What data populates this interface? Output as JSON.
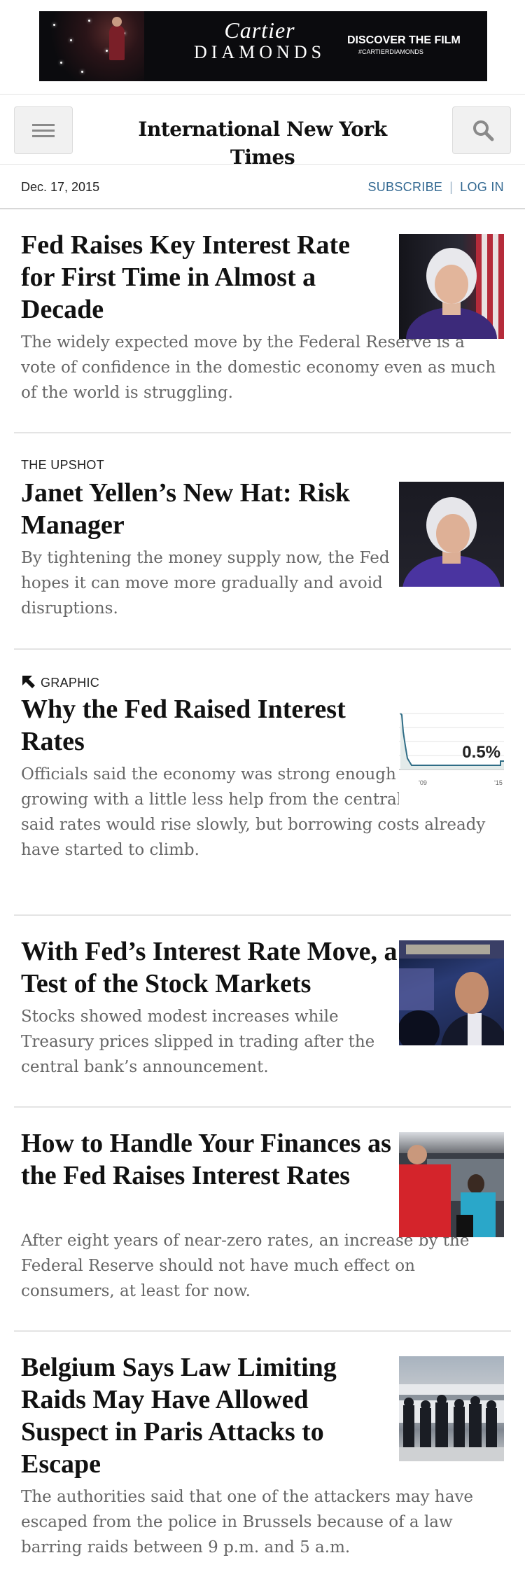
{
  "ad": {
    "brand_script": "Cartier",
    "brand_caps": "DIAMONDS",
    "cta": "DISCOVER THE FILM",
    "hashtag": "#CARTIERDIAMONDS"
  },
  "header": {
    "logo": "International New York Times",
    "menu_icon": "hamburger-menu-icon",
    "search_icon": "search-icon"
  },
  "datebar": {
    "date": "Dec. 17, 2015",
    "subscribe": "SUBSCRIBE",
    "separator": "|",
    "login": "LOG IN"
  },
  "chart_thumb": {
    "value_label": "0.5%",
    "x_tick_start": "'09",
    "x_tick_end": "'15"
  },
  "stories": [
    {
      "kicker": "",
      "headline": "Fed Raises Key Interest Rate for First Time in Almost a Decade",
      "summary": "The widely expected move by the Federal Reserve is a vote of confidence in the domestic economy even as much of the world is struggling."
    },
    {
      "kicker": "THE UPSHOT",
      "headline": "Janet Yellen’s New Hat: Risk Manager",
      "summary": "By tightening the money supply now, the Fed hopes it can move more gradually and avoid disruptions."
    },
    {
      "kicker": "GRAPHIC",
      "headline": "Why the Fed Raised Interest Rates",
      "summary": "Officials said the economy was strong enough to keep growing with a little less help from the central bank. They said rates would rise slowly, but borrowing costs already have started to climb."
    },
    {
      "kicker": "",
      "headline": "With Fed’s Interest Rate Move, a Test of the Stock Markets",
      "summary": "Stocks showed modest increases while Treasury prices slipped in trading after the central bank’s announcement."
    },
    {
      "kicker": "",
      "headline": "How to Handle Your Finances as the Fed Raises Interest Rates",
      "summary": "After eight years of near-zero rates, an increase by the Federal Reserve should not have much effect on consumers, at least for now."
    },
    {
      "kicker": "",
      "headline": "Belgium Says Law Limiting Raids May Have Allowed Suspect in Paris Attacks to Escape",
      "summary": "The authorities said that one of the attackers may have escaped from the police in Brussels because of a law barring raids between 9 p.m. and 5 a.m."
    }
  ]
}
